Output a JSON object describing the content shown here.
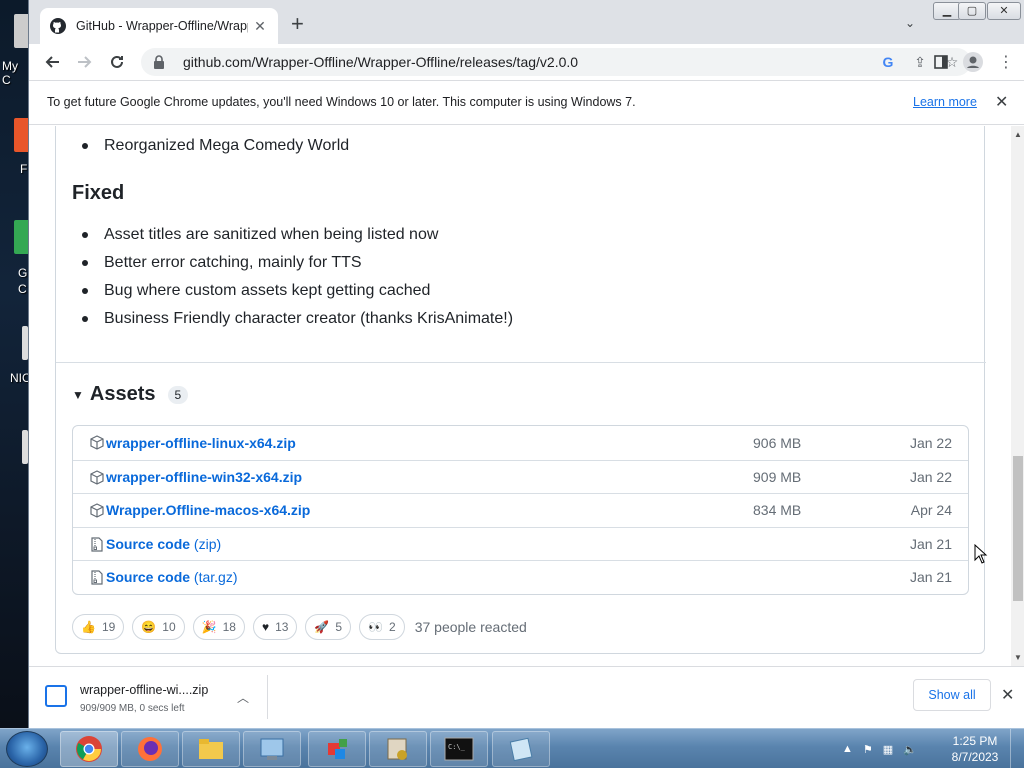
{
  "desktop": {
    "labels": [
      "My C",
      "F",
      "G",
      "C",
      "NIC"
    ]
  },
  "browser": {
    "tab_title": "GitHub - Wrapper-Offline/Wrapper-Offline",
    "url": "github.com/Wrapper-Offline/Wrapper-Offline/releases/tag/v2.0.0",
    "infobar": {
      "text": "To get future Google Chrome updates, you'll need Windows 10 or later. This computer is using Windows 7.",
      "learn_more": "Learn more"
    }
  },
  "page": {
    "changed_items": [
      "Reorganized Mega Comedy World"
    ],
    "fixed_heading": "Fixed",
    "fixed_items": [
      "Asset titles are sanitized when being listed now",
      "Better error catching, mainly for TTS",
      "Bug where custom assets kept getting cached",
      "Business Friendly character creator (thanks KrisAnimate!)"
    ],
    "assets": {
      "title": "Assets",
      "count": "5",
      "rows": [
        {
          "name": "wrapper-offline-linux-x64.zip",
          "sub": "",
          "size": "906 MB",
          "date": "Jan 22",
          "icon": "package-icon"
        },
        {
          "name": "wrapper-offline-win32-x64.zip",
          "sub": "",
          "size": "909 MB",
          "date": "Jan 22",
          "icon": "package-icon"
        },
        {
          "name": "Wrapper.Offline-macos-x64.zip",
          "sub": "",
          "size": "834 MB",
          "date": "Apr 24",
          "icon": "package-icon"
        },
        {
          "name": "Source code",
          "sub": "(zip)",
          "size": "",
          "date": "Jan 21",
          "icon": "file-zip-icon"
        },
        {
          "name": "Source code",
          "sub": "(tar.gz)",
          "size": "",
          "date": "Jan 21",
          "icon": "file-zip-icon"
        }
      ]
    },
    "reactions": [
      {
        "emoji": "thumbs-up",
        "glyph": "👍",
        "count": "19"
      },
      {
        "emoji": "laugh",
        "glyph": "😄",
        "count": "10"
      },
      {
        "emoji": "hooray",
        "glyph": "🎉",
        "count": "18"
      },
      {
        "emoji": "heart",
        "glyph": "♥",
        "count": "13"
      },
      {
        "emoji": "rocket",
        "glyph": "🚀",
        "count": "5"
      },
      {
        "emoji": "eyes",
        "glyph": "👀",
        "count": "2"
      }
    ],
    "reaction_summary": "37 people reacted"
  },
  "download": {
    "filename": "wrapper-offline-wi....zip",
    "status": "909/909 MB, 0 secs left",
    "show_all": "Show all"
  },
  "taskbar": {
    "time": "1:25 PM",
    "date": "8/7/2023"
  },
  "colors": {
    "link": "#0969da",
    "chrome_blue": "#1a73e8",
    "tabstrip": "#dee1e6"
  }
}
